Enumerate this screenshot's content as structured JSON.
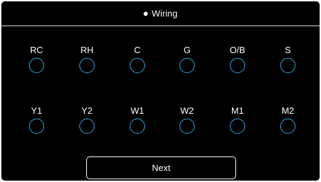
{
  "header": {
    "title": "Wiring"
  },
  "terminals": {
    "row1": [
      "RC",
      "RH",
      "C",
      "G",
      "O/B",
      "S"
    ],
    "row2": [
      "Y1",
      "Y2",
      "W1",
      "W2",
      "M1",
      "M2"
    ]
  },
  "next_button": {
    "label": "Next"
  },
  "colors": {
    "background": "#000000",
    "text": "#ffffff",
    "terminal_ring": "#2ea7e0",
    "divider": "#d9d9d9"
  }
}
